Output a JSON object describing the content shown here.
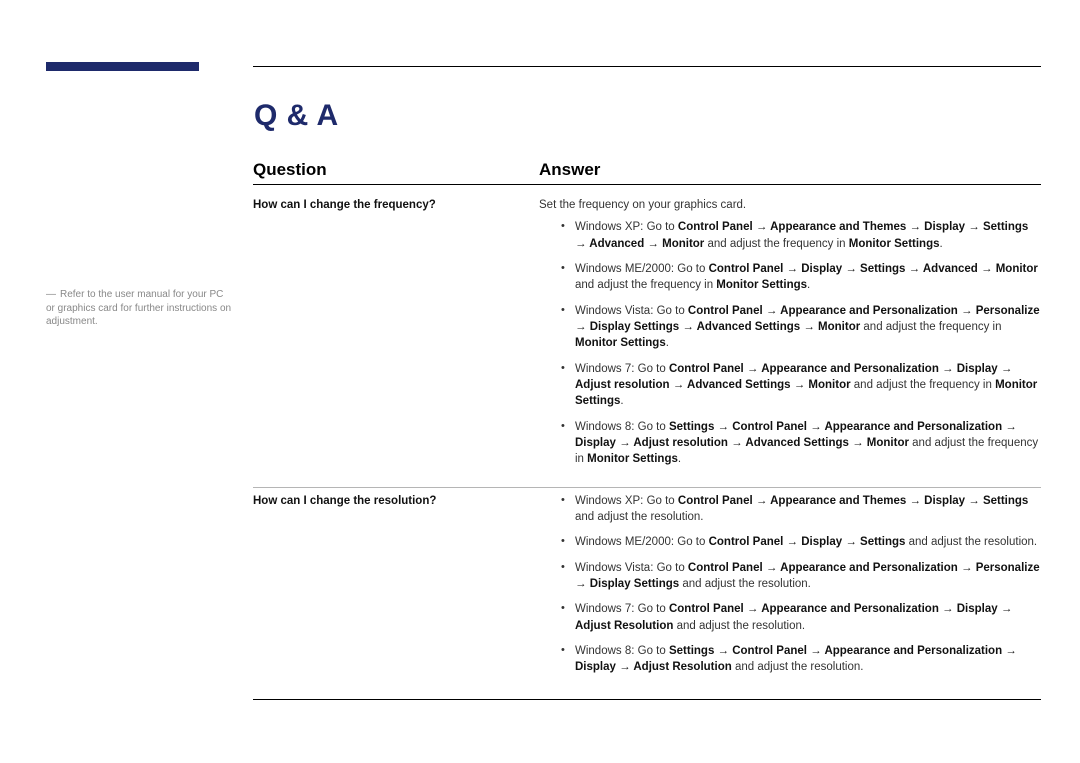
{
  "title": "Q & A",
  "columns": {
    "question": "Question",
    "answer": "Answer"
  },
  "sidenote": "Refer to the user manual for your PC or graphics card for further instructions on adjustment.",
  "rows": [
    {
      "question": "How can I change the frequency?",
      "intro": "Set the frequency on your graphics card.",
      "items": [
        {
          "html": "Windows XP: Go to <b>Control Panel → Appearance and Themes → Display → Settings → Advanced → Monitor</b> and adjust the frequency in <b>Monitor Settings</b>."
        },
        {
          "html": "Windows ME/2000: Go to <b>Control Panel → Display → Settings → Advanced → Monitor</b> and adjust the frequency in <b>Monitor Settings</b>."
        },
        {
          "html": "Windows Vista: Go to <b>Control Panel → Appearance and Personalization → Personalize → Display Settings → Advanced Settings → Monitor</b> and adjust the frequency in <b>Monitor Settings</b>."
        },
        {
          "html": "Windows 7: Go to <b>Control Panel → Appearance and Personalization → Display → Adjust resolution → Advanced Settings → Monitor</b> and adjust the frequency in <b>Monitor Settings</b>."
        },
        {
          "html": "Windows 8: Go to <b>Settings → Control Panel → Appearance and Personalization → Display → Adjust resolution → Advanced Settings → Monitor</b> and adjust the frequency in <b>Monitor Settings</b>."
        }
      ]
    },
    {
      "question": "How can I change the resolution?",
      "intro": "",
      "items": [
        {
          "html": "Windows XP: Go to <b>Control Panel → Appearance and Themes → Display → Settings</b> and adjust the resolution."
        },
        {
          "html": "Windows ME/2000: Go to <b>Control Panel → Display → Settings</b> and adjust the resolution."
        },
        {
          "html": "Windows Vista: Go to <b>Control Panel → Appearance and Personalization → Personalize → Display Settings</b> and adjust the resolution."
        },
        {
          "html": "Windows 7: Go to <b>Control Panel → Appearance and Personalization → Display → Adjust Resolution</b> and adjust the resolution."
        },
        {
          "html": "Windows 8: Go to <b>Settings → Control Panel → Appearance and Personalization → Display → Adjust Resolution</b> and adjust the resolution."
        }
      ]
    }
  ]
}
